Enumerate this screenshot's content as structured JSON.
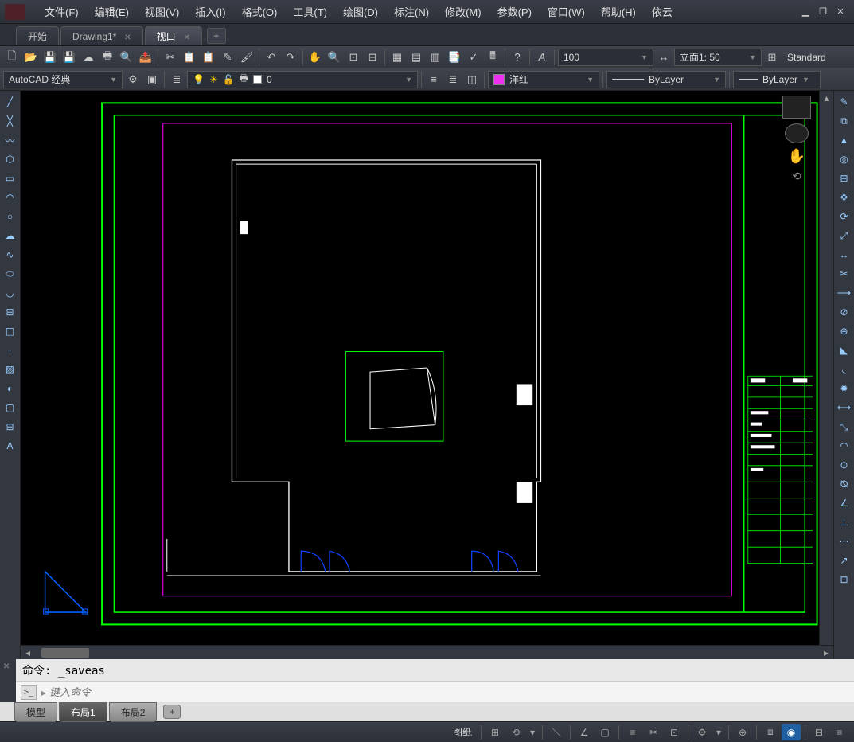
{
  "menus": [
    "文件(F)",
    "编辑(E)",
    "视图(V)",
    "插入(I)",
    "格式(O)",
    "工具(T)",
    "绘图(D)",
    "标注(N)",
    "修改(M)",
    "参数(P)",
    "窗口(W)",
    "帮助(H)",
    "依云"
  ],
  "filetabs": [
    {
      "label": "开始",
      "active": false,
      "closable": false
    },
    {
      "label": "Drawing1*",
      "active": false,
      "closable": true
    },
    {
      "label": "视口",
      "active": true,
      "closable": true
    }
  ],
  "workspace_sel": "AutoCAD 经典",
  "layer_value": "0",
  "color_value": "洋红",
  "ltype_value": "ByLayer",
  "lweight_value": "ByLayer",
  "scale_value": "100",
  "view_value": "立面1: 50",
  "style_value": "Standard",
  "cmd_hist": "命令: _saveas",
  "cmd_placeholder": "键入命令",
  "bottomtabs": [
    {
      "label": "模型",
      "active": false
    },
    {
      "label": "布局1",
      "active": true
    },
    {
      "label": "布局2",
      "active": false
    }
  ],
  "status_paper": "图纸",
  "colors": {
    "magenta": "#f030f0"
  }
}
